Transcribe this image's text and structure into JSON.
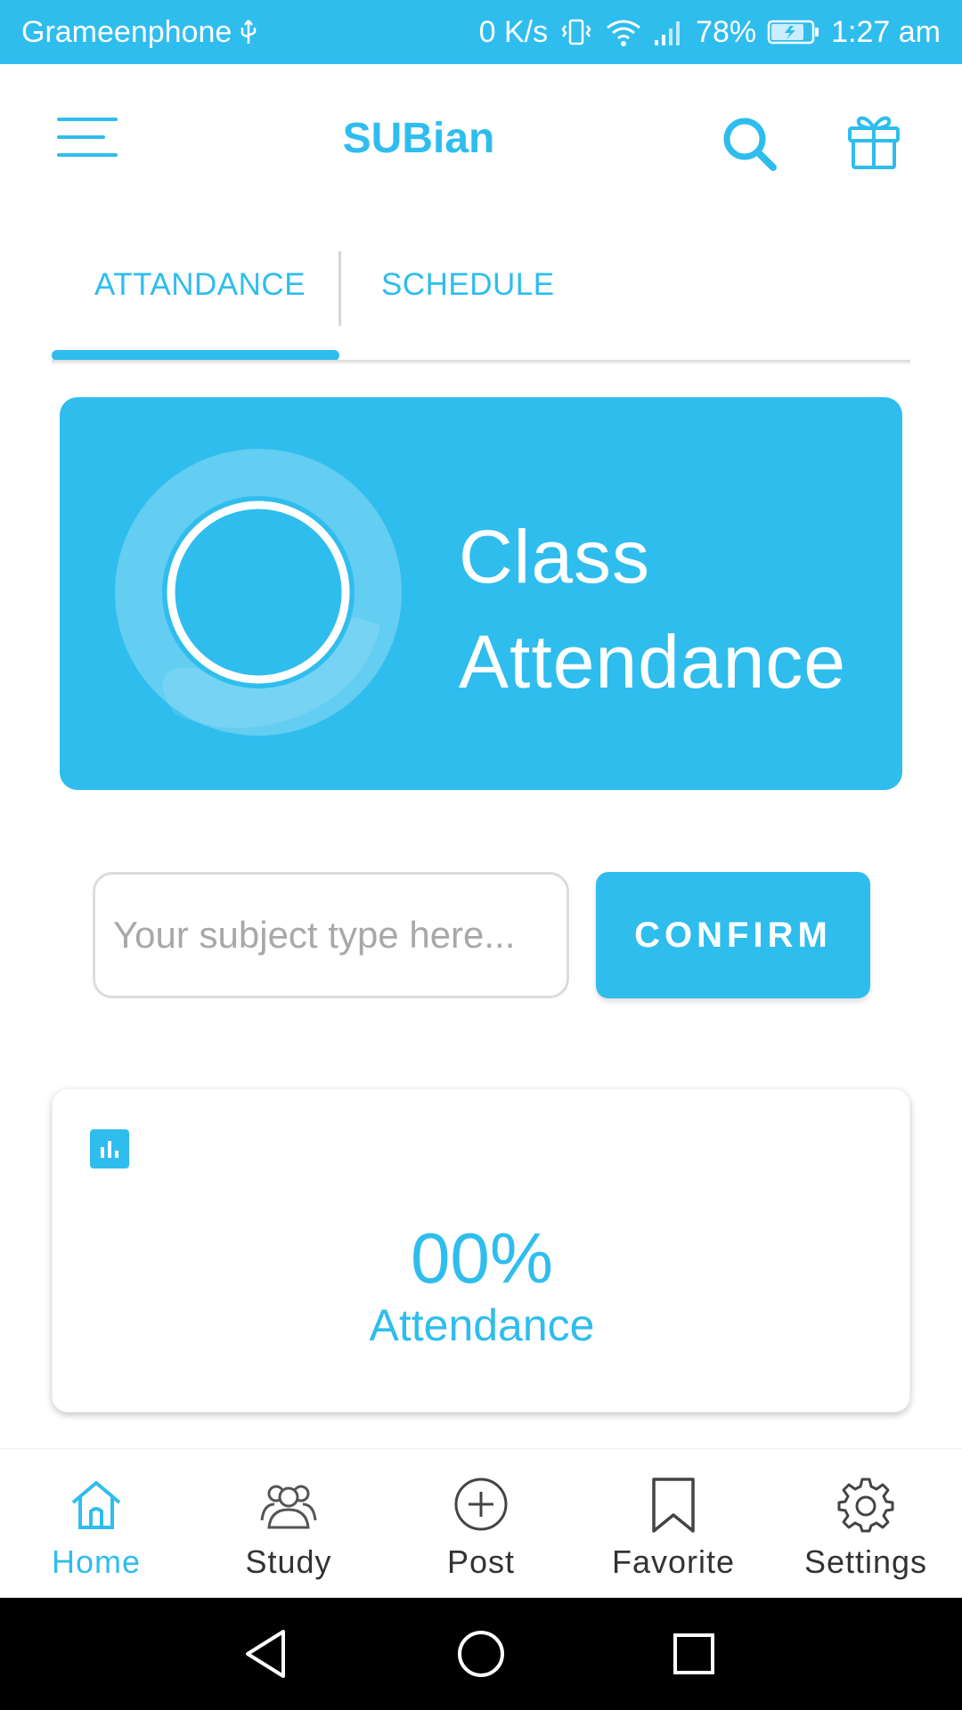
{
  "status_bar": {
    "carrier": "Grameenphone",
    "net_speed": "0 K/s",
    "battery": "78%",
    "time": "1:27 am"
  },
  "app_bar": {
    "title": "SUBian"
  },
  "tabs": [
    {
      "label": "ATTANDANCE",
      "active": true
    },
    {
      "label": "SCHEDULE",
      "active": false
    }
  ],
  "hero": {
    "title_line1": "Class",
    "title_line2": "Attendance"
  },
  "subject_input": {
    "placeholder": "Your subject type here...",
    "value": ""
  },
  "confirm_label": "CONFIRM",
  "stats": {
    "percent": "00%",
    "label": "Attendance"
  },
  "bottom_nav": [
    {
      "label": "Home",
      "icon": "home-icon",
      "active": true
    },
    {
      "label": "Study",
      "icon": "group-icon",
      "active": false
    },
    {
      "label": "Post",
      "icon": "add-circle-icon",
      "active": false
    },
    {
      "label": "Favorite",
      "icon": "bookmark-icon",
      "active": false
    },
    {
      "label": "Settings",
      "icon": "gear-icon",
      "active": false
    }
  ],
  "colors": {
    "accent": "#2fbdee",
    "text_dark": "#333333",
    "system_nav": "#000000"
  }
}
